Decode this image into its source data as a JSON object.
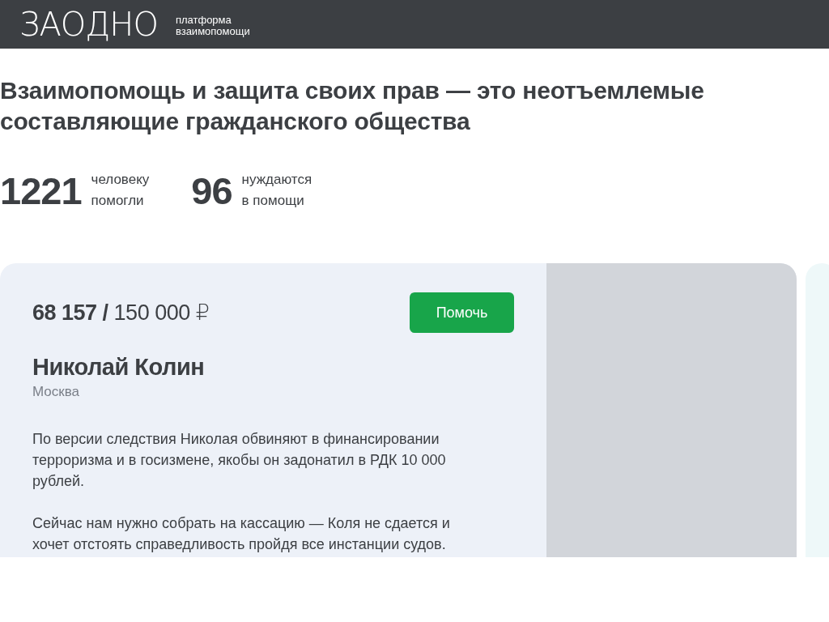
{
  "header": {
    "logo": "ЗАОДНО",
    "tagline": [
      "платформа",
      "взаимопомощи"
    ]
  },
  "headline": "Взаимопомощь и защита своих прав — это неотъемлемые составляющие гражданского общества",
  "stats": [
    {
      "number": "1221",
      "label": [
        "человеку",
        "помогли"
      ]
    },
    {
      "number": "96",
      "label": [
        "нуждаются",
        "в помощи"
      ]
    }
  ],
  "cards": [
    {
      "amount": "**68 157 /** 150 000 ₽",
      "button": "Помочь",
      "name": "Николай Колин",
      "city": "Москва",
      "paragraphs": [
        "По версии следствия Николая обвиняют в финансировании терроризма и в госизмене, якобы он задонатил в РДК 10 000 рублей.",
        "Сейчас нам нужно собрать на кассацию — Коля не сдается и хочет отстоять справедливость пройдя все инстанции судов."
      ]
    }
  ]
}
